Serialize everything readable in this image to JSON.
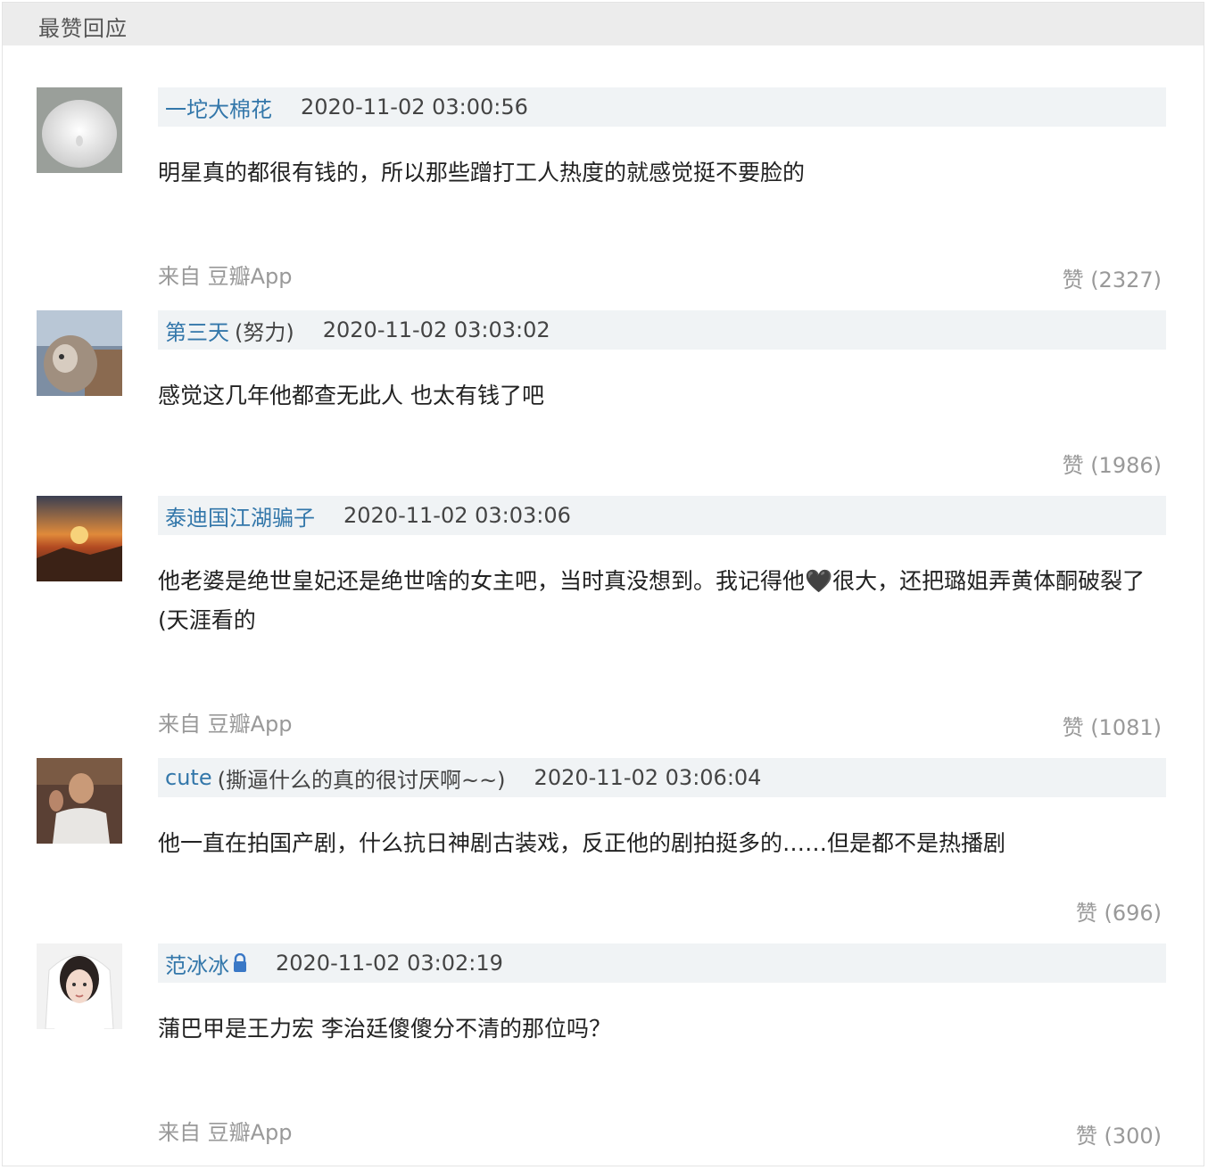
{
  "header": {
    "title": "最赞回应"
  },
  "comments": [
    {
      "user": "一坨大棉花",
      "signature": "",
      "time": "2020-11-02 03:00:56",
      "text": "明星真的都很有钱的，所以那些蹭打工人热度的就感觉挺不要脸的",
      "source": "来自 豆瓣App",
      "likes": "赞 (2327)"
    },
    {
      "user": "第三天",
      "signature": "(努力)",
      "time": "2020-11-02 03:03:02",
      "text": "感觉这几年他都查无此人 也太有钱了吧",
      "source": "",
      "likes": "赞 (1986)"
    },
    {
      "user": "泰迪国江湖骗子",
      "signature": "",
      "time": "2020-11-02 03:03:06",
      "text": "他老婆是绝世皇妃还是绝世啥的女主吧，当时真没想到。我记得他🖤很大，还把璐姐弄黄体酮破裂了(天涯看的",
      "source": "来自 豆瓣App",
      "likes": "赞 (1081)"
    },
    {
      "user": "cute",
      "signature": "(撕逼什么的真的很讨厌啊~~)",
      "time": "2020-11-02 03:06:04",
      "text": "他一直在拍国产剧，什么抗日神剧古装戏，反正他的剧拍挺多的……但是都不是热播剧",
      "source": "",
      "likes": "赞 (696)"
    },
    {
      "user": "范冰冰",
      "signature": "",
      "time": "2020-11-02 03:02:19",
      "text": "蒲巴甲是王力宏 李治廷傻傻分不清的那位吗？",
      "source": "来自 豆瓣App",
      "likes": "赞 (300)"
    }
  ]
}
